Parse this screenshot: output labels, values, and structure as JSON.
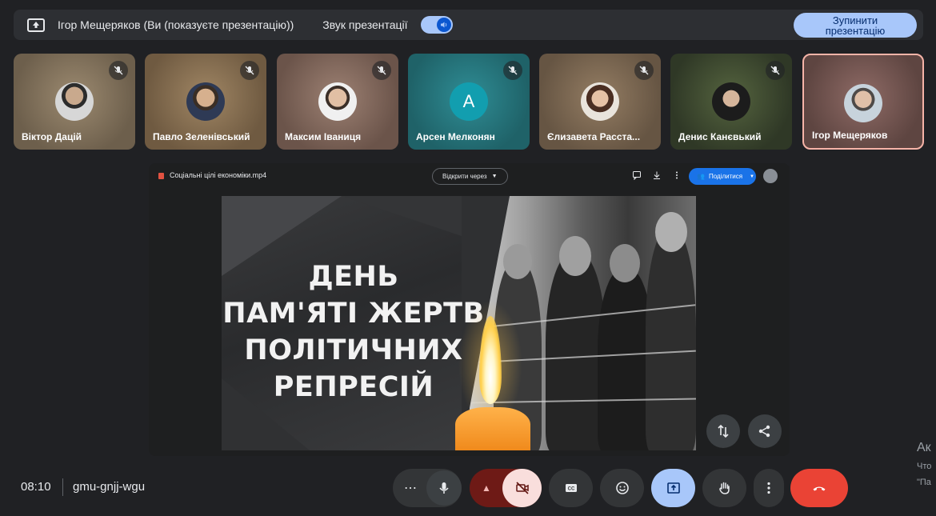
{
  "topbar": {
    "presenter_text": "Ігор Мещеряков (Ви (показуєте презентацію))",
    "sound_label": "Звук презентації",
    "sound_on": true,
    "stop_button": "Зупинити презентацію"
  },
  "participants": [
    {
      "name": "Віктор Дацій",
      "muted": true,
      "bg": "#8a7a62"
    },
    {
      "name": "Павло Зеленівський",
      "muted": true,
      "bg": "#8f7656"
    },
    {
      "name": "Максим Іваниця",
      "muted": true,
      "bg": "#8c7265"
    },
    {
      "name": "Арсен Мелконян",
      "muted": true,
      "bg": "#2a7d84",
      "initial": "A"
    },
    {
      "name": "Єлизавета Расста...",
      "muted": true,
      "bg": "#7e6b56"
    },
    {
      "name": "Денис Канєвький",
      "muted": true,
      "bg": "#44513a"
    },
    {
      "name": "Ігор Мещеряков",
      "muted": false,
      "bg": "#7d5d59",
      "active": true
    }
  ],
  "viewer": {
    "file_name": "Соціальні цілі економіки.mp4",
    "open_with": "Відкрити через",
    "share_label": "Поділитися"
  },
  "slide": {
    "title_lines": [
      "ДЕНЬ",
      "ПАМ'ЯТІ ЖЕРТВ",
      "ПОЛІТИЧНИХ",
      "РЕПРЕСІЙ"
    ]
  },
  "bottom": {
    "time": "08:10",
    "meeting_code": "gmu-gnjj-wgu"
  },
  "side_clip": [
    "Ак",
    "Что",
    "\"Па"
  ],
  "colors": {
    "accent": "#a8c7fa",
    "end_call": "#ea4335",
    "camera_off": "#f9dedc"
  }
}
